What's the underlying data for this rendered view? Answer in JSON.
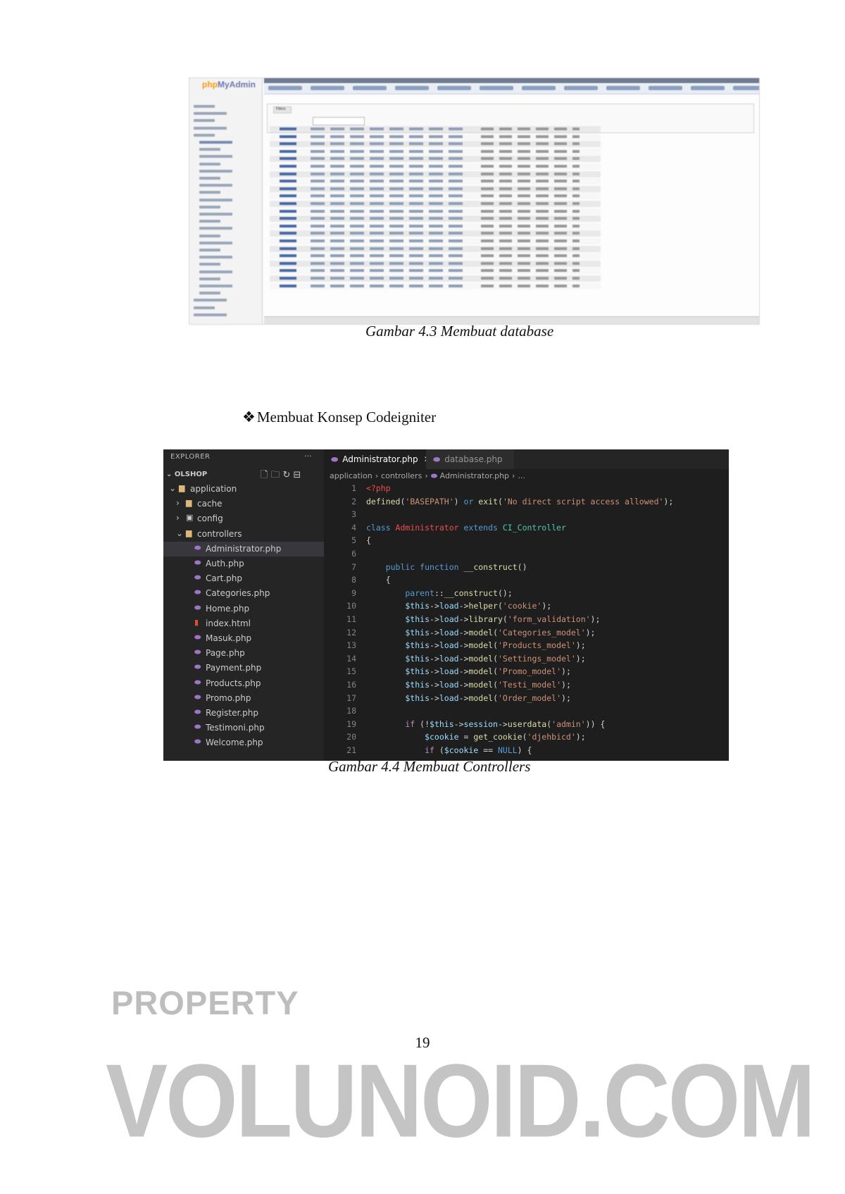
{
  "figure_db": {
    "logo_php": "php",
    "logo_my_admin": "MyAdmin",
    "filters_label": "Filters",
    "caption": "Gambar 4.3 Membuat database"
  },
  "section": {
    "bullet_symbol": "❖",
    "heading": "Membuat Konsep Codeigniter"
  },
  "figure_code": {
    "explorer": {
      "title": "EXPLORER",
      "dots": "···",
      "project": "OLSHOP",
      "tree": [
        {
          "label": "application",
          "type": "folder",
          "chevron": "v",
          "depth": 1
        },
        {
          "label": "cache",
          "type": "folder",
          "chevron": ">",
          "depth": 2
        },
        {
          "label": "config",
          "type": "config",
          "chevron": ">",
          "depth": 2
        },
        {
          "label": "controllers",
          "type": "folder",
          "chevron": "v",
          "depth": 2
        },
        {
          "label": "Administrator.php",
          "type": "php",
          "depth": 3,
          "selected": true
        },
        {
          "label": "Auth.php",
          "type": "php",
          "depth": 3
        },
        {
          "label": "Cart.php",
          "type": "php",
          "depth": 3
        },
        {
          "label": "Categories.php",
          "type": "php",
          "depth": 3
        },
        {
          "label": "Home.php",
          "type": "php",
          "depth": 3
        },
        {
          "label": "index.html",
          "type": "html",
          "depth": 3
        },
        {
          "label": "Masuk.php",
          "type": "php",
          "depth": 3
        },
        {
          "label": "Page.php",
          "type": "php",
          "depth": 3
        },
        {
          "label": "Payment.php",
          "type": "php",
          "depth": 3
        },
        {
          "label": "Products.php",
          "type": "php",
          "depth": 3
        },
        {
          "label": "Promo.php",
          "type": "php",
          "depth": 3
        },
        {
          "label": "Register.php",
          "type": "php",
          "depth": 3
        },
        {
          "label": "Testimoni.php",
          "type": "php",
          "depth": 3
        },
        {
          "label": "Welcome.php",
          "type": "php",
          "depth": 3
        }
      ]
    },
    "tabs": [
      {
        "label": "Administrator.php",
        "active": true,
        "close": "✕"
      },
      {
        "label": "database.php",
        "active": false
      }
    ],
    "breadcrumb": [
      "application",
      "controllers",
      "Administrator.php",
      "..."
    ],
    "code_lines": [
      [
        [
          "<?php",
          "red"
        ]
      ],
      [
        [
          "defined",
          "f"
        ],
        [
          "(",
          "c"
        ],
        [
          "'BASEPATH'",
          "s"
        ],
        [
          ") ",
          "c"
        ],
        [
          "or ",
          "k"
        ],
        [
          "exit",
          "f"
        ],
        [
          "(",
          "c"
        ],
        [
          "'No direct script access allowed'",
          "s"
        ],
        [
          ");",
          "c"
        ]
      ],
      [],
      [
        [
          "class ",
          "k"
        ],
        [
          "Administrator ",
          "red"
        ],
        [
          "extends ",
          "k"
        ],
        [
          "CI_Controller",
          "cls"
        ]
      ],
      [
        [
          "{",
          "c"
        ]
      ],
      [],
      [
        [
          "    public ",
          "k"
        ],
        [
          "function ",
          "k"
        ],
        [
          "__construct",
          "f"
        ],
        [
          "()",
          "c"
        ]
      ],
      [
        [
          "    {",
          "c"
        ]
      ],
      [
        [
          "        parent",
          "k"
        ],
        [
          "::",
          "c"
        ],
        [
          "__construct",
          "f"
        ],
        [
          "();",
          "c"
        ]
      ],
      [
        [
          "        $this",
          "v"
        ],
        [
          "->",
          "c"
        ],
        [
          "load",
          "v"
        ],
        [
          "->",
          "c"
        ],
        [
          "helper",
          "f"
        ],
        [
          "(",
          "c"
        ],
        [
          "'cookie'",
          "s"
        ],
        [
          ");",
          "c"
        ]
      ],
      [
        [
          "        $this",
          "v"
        ],
        [
          "->",
          "c"
        ],
        [
          "load",
          "v"
        ],
        [
          "->",
          "c"
        ],
        [
          "library",
          "f"
        ],
        [
          "(",
          "c"
        ],
        [
          "'form_validation'",
          "s"
        ],
        [
          ");",
          "c"
        ]
      ],
      [
        [
          "        $this",
          "v"
        ],
        [
          "->",
          "c"
        ],
        [
          "load",
          "v"
        ],
        [
          "->",
          "c"
        ],
        [
          "model",
          "f"
        ],
        [
          "(",
          "c"
        ],
        [
          "'Categories_model'",
          "s"
        ],
        [
          ");",
          "c"
        ]
      ],
      [
        [
          "        $this",
          "v"
        ],
        [
          "->",
          "c"
        ],
        [
          "load",
          "v"
        ],
        [
          "->",
          "c"
        ],
        [
          "model",
          "f"
        ],
        [
          "(",
          "c"
        ],
        [
          "'Products_model'",
          "s"
        ],
        [
          ");",
          "c"
        ]
      ],
      [
        [
          "        $this",
          "v"
        ],
        [
          "->",
          "c"
        ],
        [
          "load",
          "v"
        ],
        [
          "->",
          "c"
        ],
        [
          "model",
          "f"
        ],
        [
          "(",
          "c"
        ],
        [
          "'Settings_model'",
          "s"
        ],
        [
          ");",
          "c"
        ]
      ],
      [
        [
          "        $this",
          "v"
        ],
        [
          "->",
          "c"
        ],
        [
          "load",
          "v"
        ],
        [
          "->",
          "c"
        ],
        [
          "model",
          "f"
        ],
        [
          "(",
          "c"
        ],
        [
          "'Promo_model'",
          "s"
        ],
        [
          ");",
          "c"
        ]
      ],
      [
        [
          "        $this",
          "v"
        ],
        [
          "->",
          "c"
        ],
        [
          "load",
          "v"
        ],
        [
          "->",
          "c"
        ],
        [
          "model",
          "f"
        ],
        [
          "(",
          "c"
        ],
        [
          "'Testi_model'",
          "s"
        ],
        [
          ");",
          "c"
        ]
      ],
      [
        [
          "        $this",
          "v"
        ],
        [
          "->",
          "c"
        ],
        [
          "load",
          "v"
        ],
        [
          "->",
          "c"
        ],
        [
          "model",
          "f"
        ],
        [
          "(",
          "c"
        ],
        [
          "'Order_model'",
          "s"
        ],
        [
          ");",
          "c"
        ]
      ],
      [],
      [
        [
          "        if ",
          "ctl"
        ],
        [
          "(!",
          "c"
        ],
        [
          "$this",
          "v"
        ],
        [
          "->",
          "c"
        ],
        [
          "session",
          "v"
        ],
        [
          "->",
          "c"
        ],
        [
          "userdata",
          "f"
        ],
        [
          "(",
          "c"
        ],
        [
          "'admin'",
          "s"
        ],
        [
          ")) {",
          "c"
        ]
      ],
      [
        [
          "            $cookie ",
          "v"
        ],
        [
          "= ",
          "c"
        ],
        [
          "get_cookie",
          "f"
        ],
        [
          "(",
          "c"
        ],
        [
          "'djehbicd'",
          "s"
        ],
        [
          ");",
          "c"
        ]
      ],
      [
        [
          "            if ",
          "ctl"
        ],
        [
          "(",
          "c"
        ],
        [
          "$cookie ",
          "v"
        ],
        [
          "== ",
          "c"
        ],
        [
          "NULL",
          "k"
        ],
        [
          ") {",
          "c"
        ]
      ]
    ],
    "caption": "Gambar 4.4 Membuat Controllers"
  },
  "page_number": "19",
  "watermark": {
    "line1": "PROPERTY",
    "line2": "VOLUNOID.COM"
  }
}
